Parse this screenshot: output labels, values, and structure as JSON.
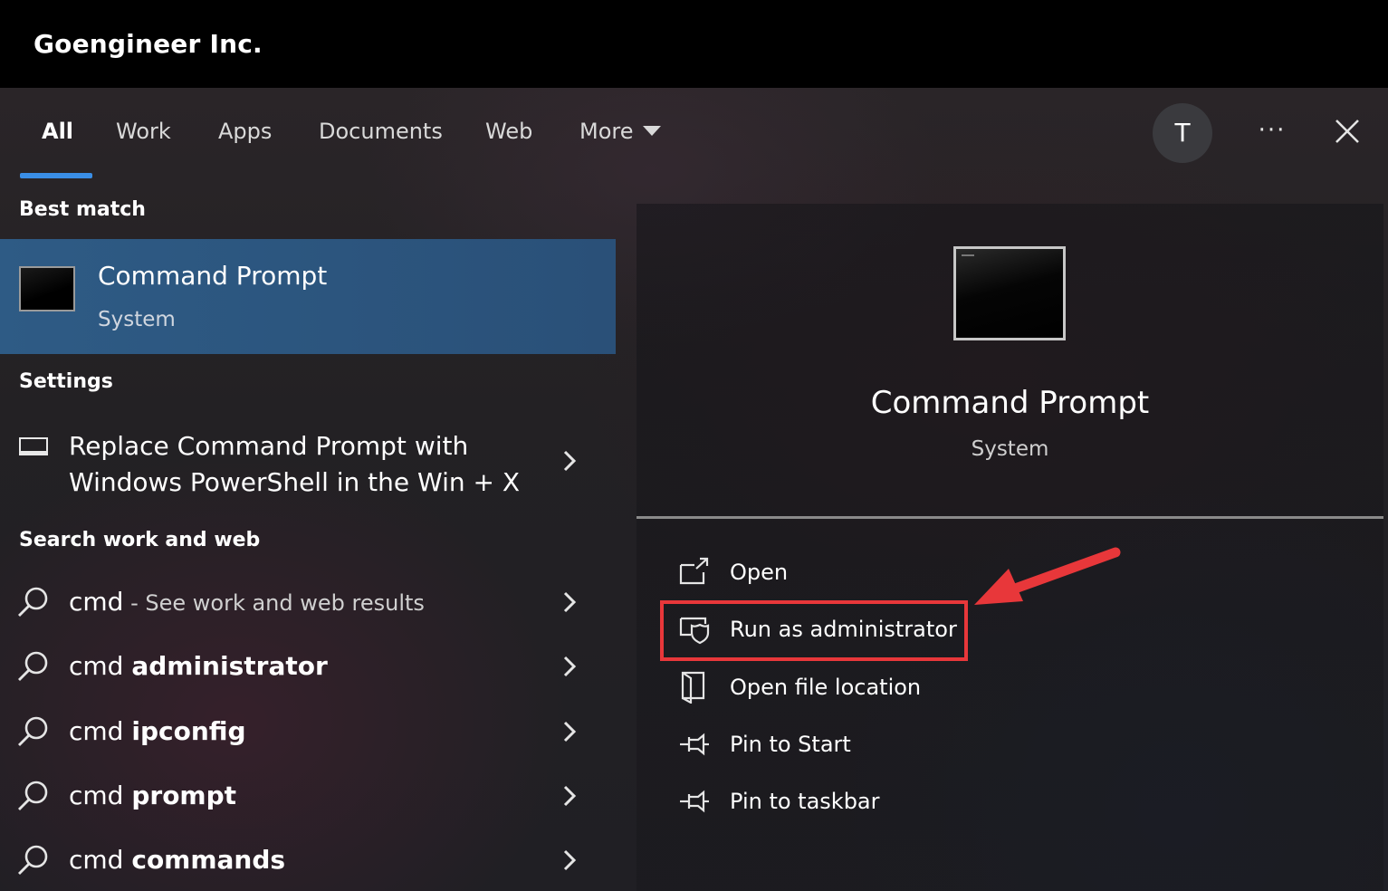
{
  "app": {
    "title": "Goengineer Inc."
  },
  "tabs": [
    {
      "label": "All",
      "active": true
    },
    {
      "label": "Work",
      "active": false
    },
    {
      "label": "Apps",
      "active": false
    },
    {
      "label": "Documents",
      "active": false
    },
    {
      "label": "Web",
      "active": false
    },
    {
      "label": "More",
      "active": false
    }
  ],
  "header": {
    "avatar_initial": "T",
    "ellipsis_icon": "more-options-icon",
    "close_icon": "close-icon"
  },
  "best_match": {
    "section_label": "Best match",
    "title": "Command Prompt",
    "subtitle": "System",
    "icon": "command-prompt-icon"
  },
  "settings": {
    "section_label": "Settings",
    "item": {
      "line1": "Replace Command Prompt with",
      "line2": "Windows PowerShell in the Win + X",
      "icon": "keyboard-icon"
    }
  },
  "search_web": {
    "section_label": "Search work and web",
    "items": [
      {
        "prefix": "cmd",
        "bold": "",
        "hint": " - See work and web results"
      },
      {
        "prefix": "cmd ",
        "bold": "administrator",
        "hint": ""
      },
      {
        "prefix": "cmd ",
        "bold": "ipconfig",
        "hint": ""
      },
      {
        "prefix": "cmd ",
        "bold": "prompt",
        "hint": ""
      },
      {
        "prefix": "cmd ",
        "bold": "commands",
        "hint": ""
      }
    ]
  },
  "detail": {
    "title": "Command Prompt",
    "subtitle": "System",
    "actions": [
      {
        "label": "Open",
        "icon": "open-icon"
      },
      {
        "label": "Run as administrator",
        "icon": "shield-icon"
      },
      {
        "label": "Open file location",
        "icon": "file-location-icon"
      },
      {
        "label": "Pin to Start",
        "icon": "pin-icon"
      },
      {
        "label": "Pin to taskbar",
        "icon": "pin-icon"
      }
    ]
  },
  "colors": {
    "accent": "#3a8ee6",
    "selection": "#2e5b85",
    "annotation": "#e8373a"
  }
}
